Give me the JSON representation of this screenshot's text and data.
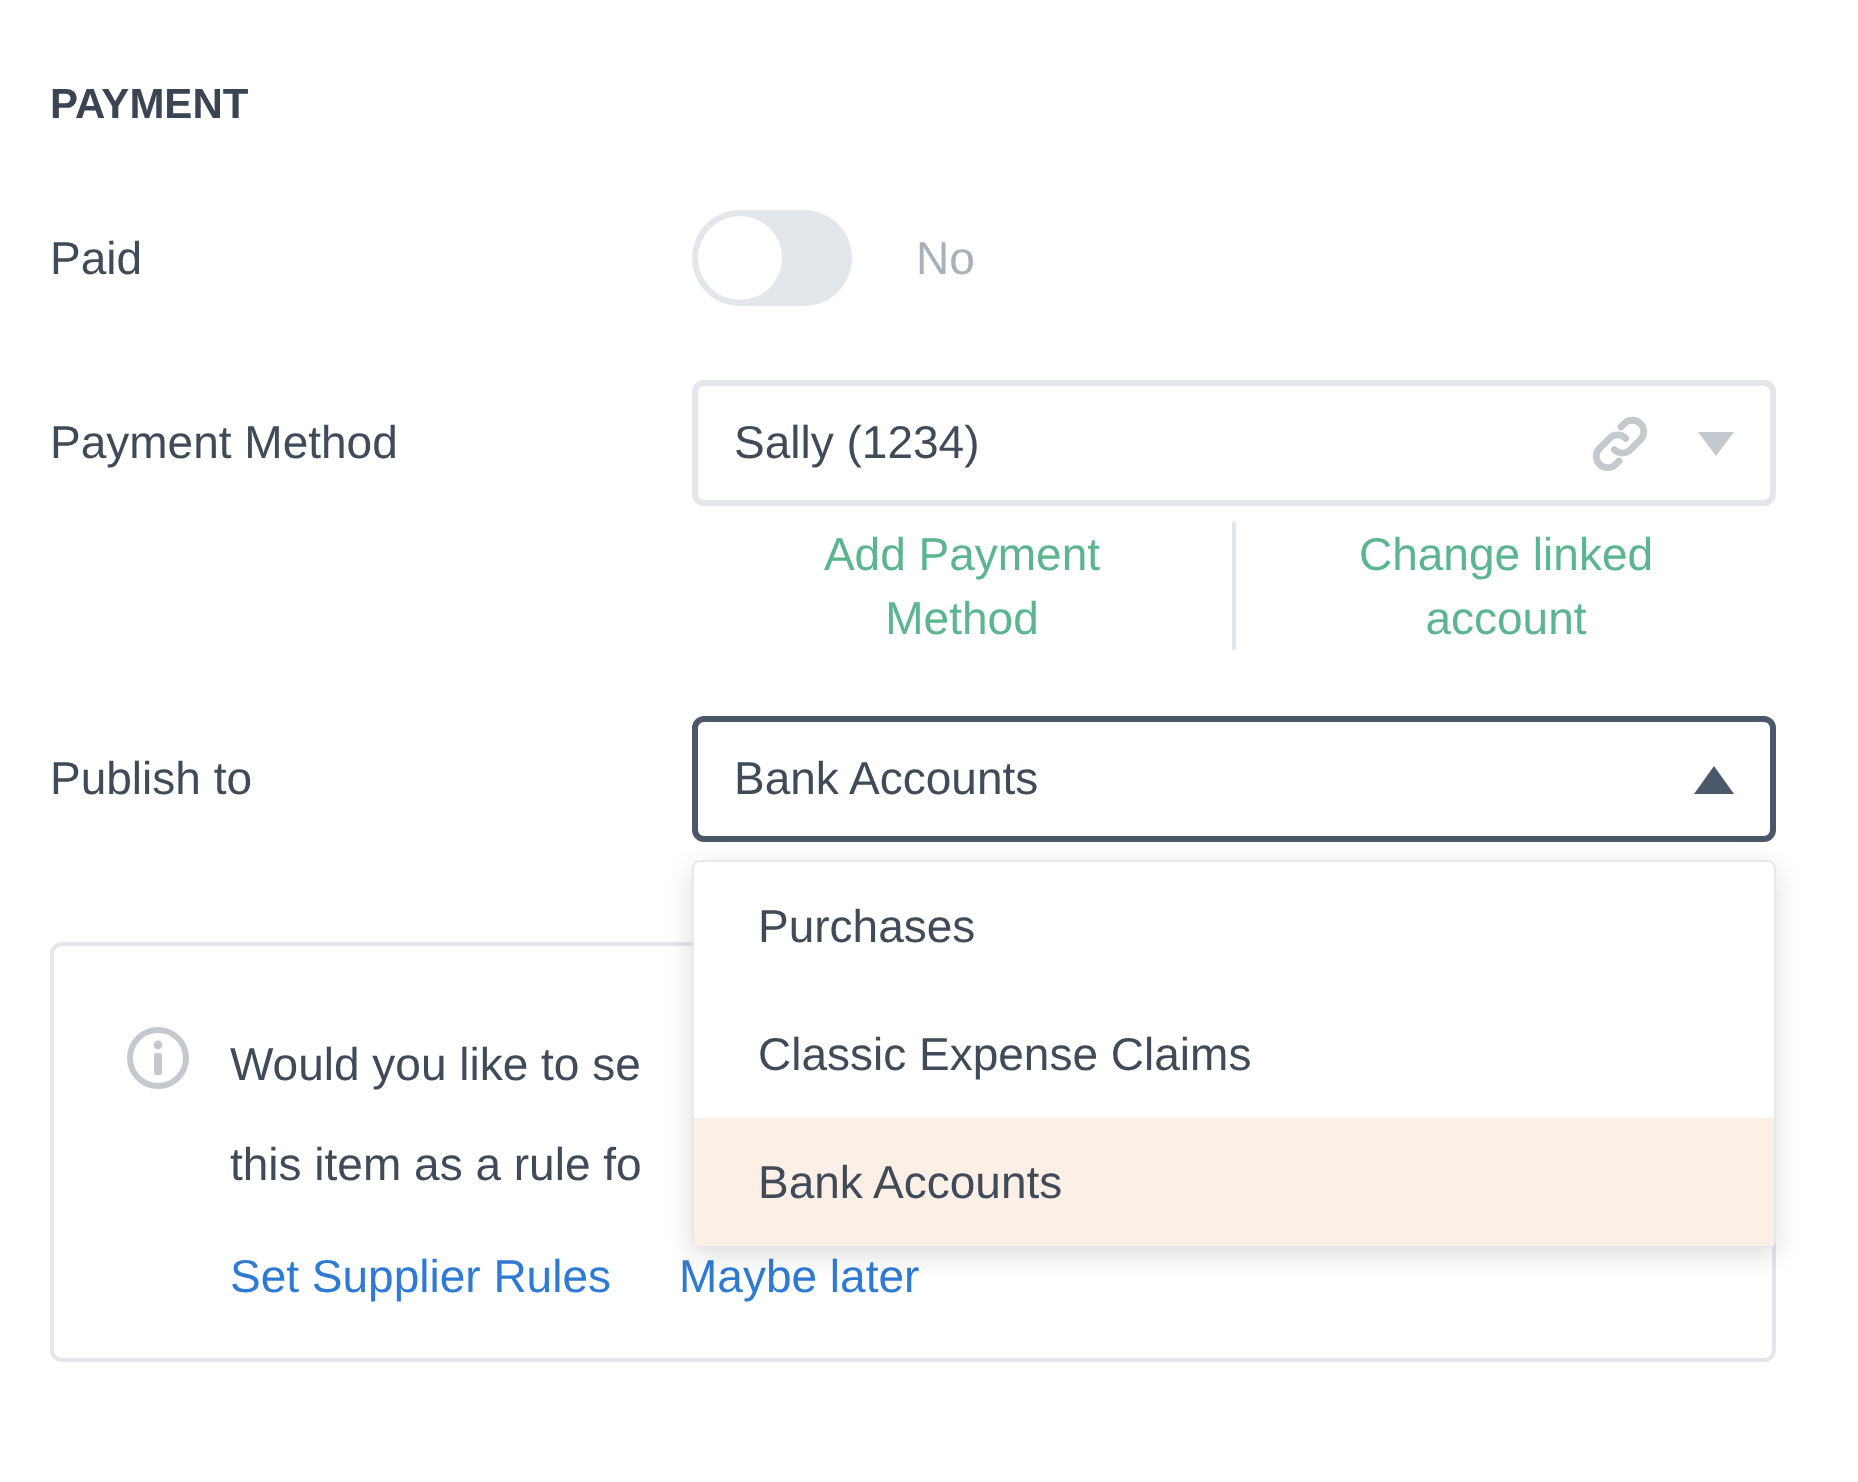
{
  "section_title": "PAYMENT",
  "paid": {
    "label": "Paid",
    "on": false,
    "state_text": "No"
  },
  "payment_method": {
    "label": "Payment Method",
    "value": "Sally (1234)",
    "links": [
      "Add Payment Method",
      "Change linked account"
    ]
  },
  "publish_to": {
    "label": "Publish to",
    "value": "Bank Accounts",
    "expanded": true,
    "options": [
      {
        "label": "Purchases",
        "selected": false
      },
      {
        "label": "Classic Expense Claims",
        "selected": false
      },
      {
        "label": "Bank Accounts",
        "selected": true
      }
    ]
  },
  "info": {
    "lines": [
      "Would you like to se",
      "this item as a rule fo"
    ],
    "links": [
      "Set Supplier Rules",
      "Maybe later"
    ]
  }
}
